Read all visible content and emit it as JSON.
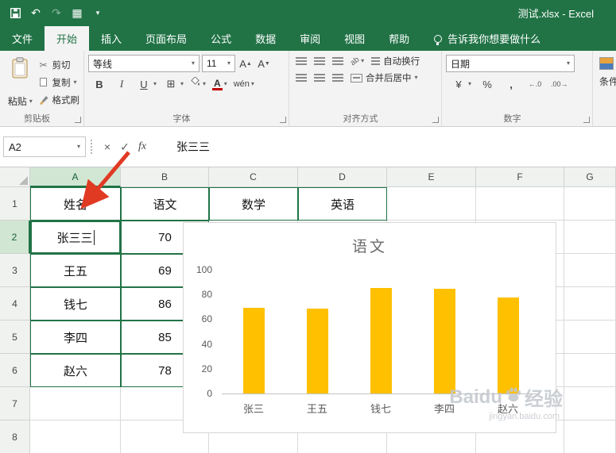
{
  "colors": {
    "excel_green": "#217346",
    "ribbon_bg": "#f3f3f3",
    "bar_yellow": "#FFC000",
    "selection_border": "#217346",
    "arrow_red": "#e03a23"
  },
  "title_bar": {
    "title": "测试.xlsx - Excel"
  },
  "icons": {
    "undo": "↶",
    "redo": "↷",
    "touch_grid": "▦",
    "dropdown": "▾",
    "scissors": "✂",
    "borders": "⊞",
    "orientation": "ab",
    "cancel": "×",
    "check": "✓"
  },
  "tabs": {
    "items": [
      "文件",
      "开始",
      "插入",
      "页面布局",
      "公式",
      "数据",
      "审阅",
      "视图",
      "帮助"
    ],
    "active": "开始",
    "tell_me": "告诉我你想要做什么"
  },
  "ribbon": {
    "clipboard": {
      "group_label": "剪贴板",
      "paste": "粘贴",
      "cut": "剪切",
      "copy": "复制",
      "format_painter": "格式刷"
    },
    "font": {
      "group_label": "字体",
      "font_name": "等线",
      "font_size": "11",
      "bold": "B",
      "italic": "I",
      "underline": "U",
      "increase_font": "A",
      "decrease_font": "A",
      "phonetic": "wén"
    },
    "alignment": {
      "group_label": "对齐方式",
      "wrap_text": "自动换行",
      "merge_center": "合并后居中"
    },
    "number": {
      "group_label": "数字",
      "format": "日期",
      "accounting": "¥",
      "percent": "%",
      "comma": ",",
      "decimal_inc": "←.0",
      "decimal_dec": ".00→"
    },
    "conditional": {
      "label": "条件"
    }
  },
  "formula_bar": {
    "name_box": "A2",
    "fx_label": "fx",
    "content": "张三三"
  },
  "sheet": {
    "col_headers": [
      "A",
      "B",
      "C",
      "D",
      "E",
      "F",
      "G"
    ],
    "row_headers": [
      "1",
      "2",
      "3",
      "4",
      "5",
      "6",
      "7",
      "8"
    ],
    "selected_cell": "A2",
    "selected_col": "A",
    "selected_row": "2",
    "cells": {
      "A1": "姓名",
      "B1": "语文",
      "C1": "数学",
      "D1": "英语",
      "A2": "张三三",
      "B2": "70",
      "A3": "王五",
      "B3": "69",
      "A4": "钱七",
      "B4": "86",
      "A5": "李四",
      "B5": "85",
      "A6": "赵六",
      "B6": "78"
    }
  },
  "chart_data": {
    "type": "bar",
    "title": "语文",
    "categories": [
      "张三",
      "王五",
      "钱七",
      "李四",
      "赵六"
    ],
    "values": [
      70,
      69,
      86,
      85,
      78
    ],
    "xlabel": "",
    "ylabel": "",
    "ylim": [
      0,
      100
    ],
    "yticks": [
      0,
      20,
      40,
      60,
      80,
      100
    ],
    "grid": false,
    "legend": "none",
    "bar_color": "#FFC000"
  },
  "watermark": {
    "brand": "Baidu",
    "brand_cn": "经验",
    "url": "jingyan.baidu.com"
  }
}
